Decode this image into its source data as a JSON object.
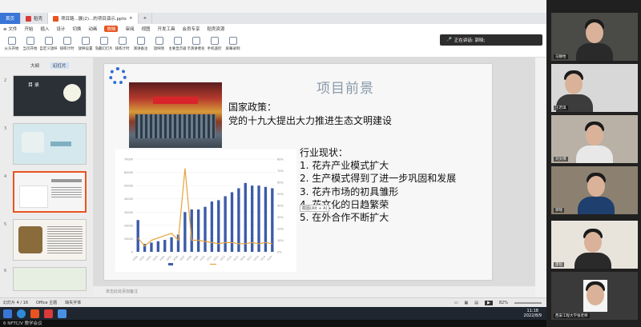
{
  "titlebar_text": "...",
  "tabs": [
    {
      "label": "首页",
      "kind": "home"
    },
    {
      "label": "稻壳",
      "kind": "normal",
      "color": "#d93a3a"
    },
    {
      "label": "项目路...展(2)...的项目演示.pptx",
      "kind": "active",
      "color": "#e8541f"
    }
  ],
  "ribbon_tabs": [
    "开始",
    "插入",
    "设计",
    "切换",
    "动画",
    "放映",
    "审阅",
    "视图",
    "开发工具",
    "会员专享",
    "稻壳资源"
  ],
  "ribbon_highlight": "放映",
  "ribbon_buttons": [
    "从头开始",
    "当页开始",
    "自定义放映",
    "排练计时",
    "放映设置",
    "隐藏幻灯片",
    "排练计时",
    "演讲备注",
    "放映到",
    "主要显示器",
    "显示演讲者视图",
    "手机遥控",
    "屏幕录制"
  ],
  "left_panel": {
    "tabs": [
      "大纲",
      "幻灯片"
    ],
    "slide_numbers": [
      "1",
      "2",
      "3",
      "4",
      "5",
      "6"
    ],
    "thumb1_title": "目 录"
  },
  "slide": {
    "title": "项目前景",
    "policy_label": "国家政策：",
    "policy_text": "党的十九大提出大力推进生态文明建设",
    "status_title": "行业现状：",
    "status_items": [
      "1. 花卉产业模式扩大",
      "2. 生产模式得到了进一步巩固和发展",
      "3. 花卉市场的初具雏形",
      "4. 花文化的日趋繁荣",
      "5. 在外合作不断扩大"
    ],
    "tooltip": "截图(Alt + A)"
  },
  "notes_placeholder": "单击此处添加备注",
  "statusbar": {
    "slide_index": "幻灯片 4 / 16",
    "theme": "Office 主题",
    "missing_font": "缺失字体",
    "zoom": "82%"
  },
  "taskbar": {
    "time": "11:18",
    "date": "2022/8/9"
  },
  "caption": "6 NFTC/V 教学会议",
  "toast": "正在讲话: 郭晓;",
  "participants": [
    "马静怡",
    "王若琪",
    "刘文博",
    "郭晓",
    "邵恒",
    "西安工程大学张老师"
  ],
  "chart_data": {
    "type": "bar",
    "categories": [
      "2000",
      "2001",
      "2002",
      "2003",
      "2004",
      "2005",
      "2006",
      "2007",
      "2008",
      "2009",
      "2010",
      "2011",
      "2012",
      "2013",
      "2014",
      "2015",
      "2016",
      "2017",
      "2018",
      "2019",
      "2020"
    ],
    "series": [
      {
        "name": "",
        "kind": "bar",
        "axis": "left",
        "color": "#3b5ba8",
        "values": [
          24000,
          6000,
          7000,
          8000,
          9000,
          11000,
          13000,
          30000,
          32000,
          32000,
          34000,
          38000,
          39000,
          42000,
          45000,
          48000,
          52000,
          50000,
          50000,
          49000,
          48000
        ]
      },
      {
        "name": "",
        "kind": "line",
        "axis": "right",
        "color": "#e8a23a",
        "values": [
          12,
          5,
          10,
          12,
          14,
          16,
          10,
          72,
          10,
          10,
          9,
          8,
          7,
          8,
          8,
          7,
          7,
          8,
          7,
          8,
          7
        ]
      }
    ],
    "ylim": [
      0,
      70000
    ],
    "y2lim": [
      0,
      80
    ],
    "yticks": [
      "0",
      "10000",
      "20000",
      "30000",
      "40000",
      "50000",
      "60000",
      "70000"
    ],
    "y2ticks": [
      "0%",
      "10%",
      "20%",
      "30%",
      "40%",
      "50%",
      "60%",
      "70%",
      "80%"
    ]
  }
}
